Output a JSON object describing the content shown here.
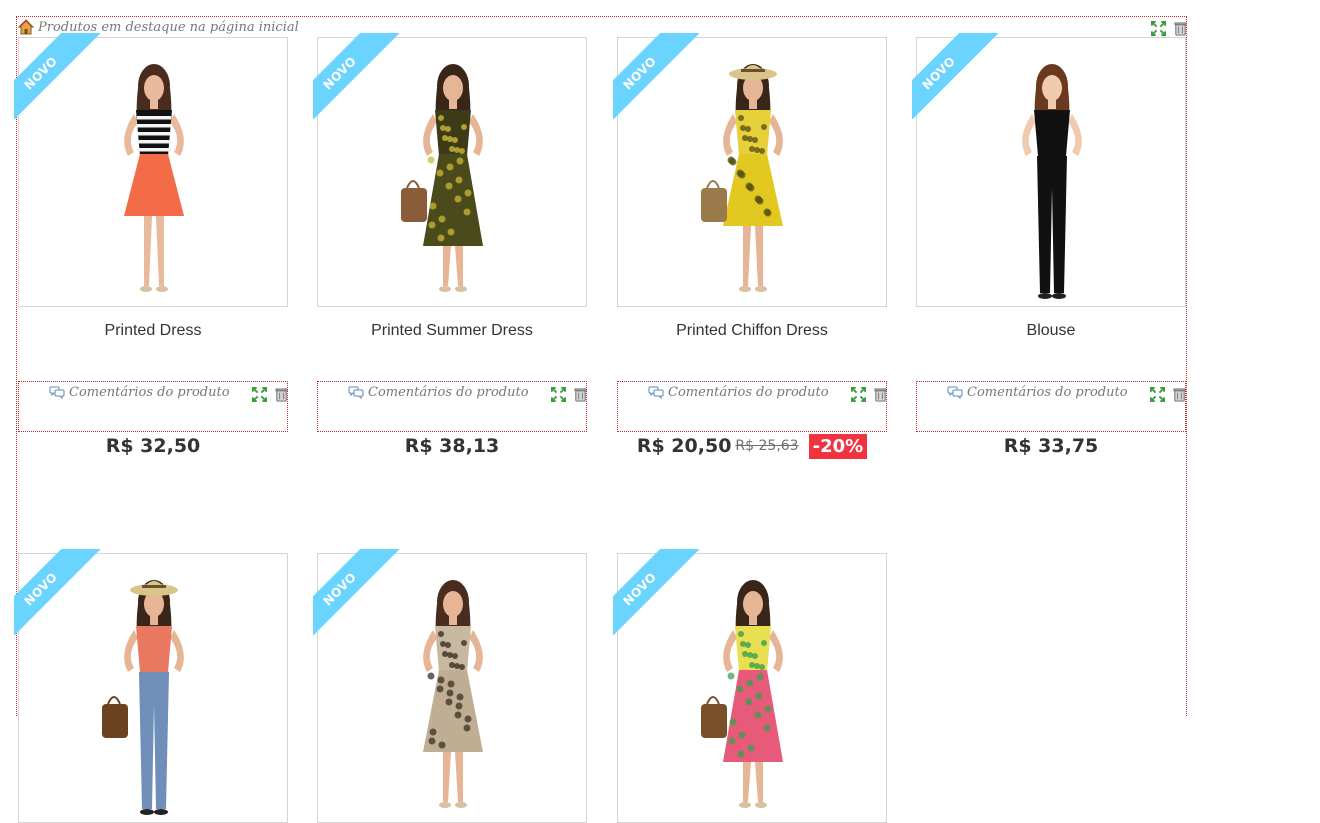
{
  "module": {
    "title": "Produtos em destaque na página inicial"
  },
  "badge_label": "NOVO",
  "comments_label": "Comentários do produto",
  "colors": {
    "badge": "#6ad4ff",
    "discount": "#f13340",
    "module_border": "#c0282d"
  },
  "products": [
    {
      "name": "Printed Dress",
      "price": "R$ 32,50",
      "badge": "NOVO"
    },
    {
      "name": "Printed Summer Dress",
      "price": "R$ 38,13",
      "badge": "NOVO"
    },
    {
      "name": "Printed Chiffon Dress",
      "price": "R$ 20,50",
      "old_price": "R$ 25,63",
      "reduction": "-20%",
      "badge": "NOVO"
    },
    {
      "name": "Blouse",
      "price": "R$ 33,75",
      "badge": "NOVO"
    },
    {
      "badge": "NOVO"
    },
    {
      "badge": "NOVO"
    },
    {
      "badge": "NOVO"
    }
  ],
  "icons": {
    "module_title": "home-icon",
    "expand": "expand-icon",
    "delete": "trash-icon",
    "comments": "chat-bubbles-icon"
  }
}
